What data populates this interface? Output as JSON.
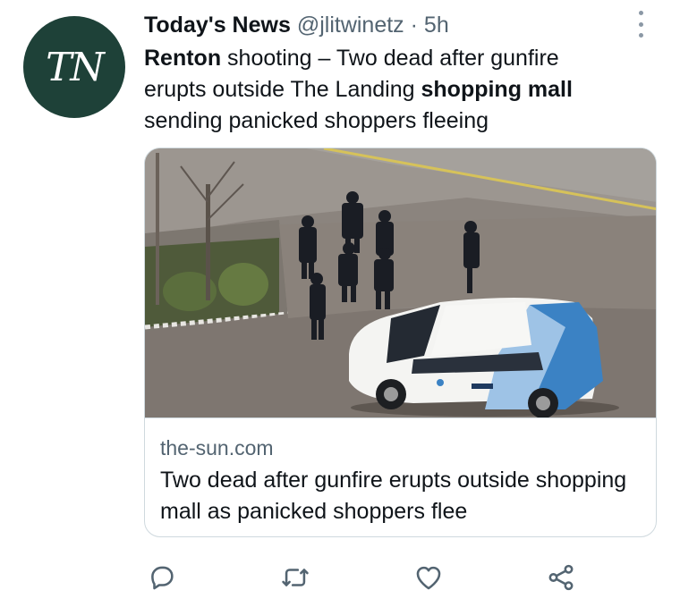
{
  "tweet": {
    "avatar_text": "TN",
    "author_name": "Today's News",
    "handle": "@jlitwinetz",
    "separator": "·",
    "time": "5h",
    "text_parts": {
      "p1_bold": "Renton",
      "p2": " shooting – Two dead after gunfire erupts outside The Landing ",
      "p3_bold": "shopping mall",
      "p4": " sending panicked shoppers fleeing"
    }
  },
  "card": {
    "domain": "the-sun.com",
    "title": "Two dead after gunfire erupts outside shopping mall as panicked shoppers flee",
    "image_content": "Aerial view of police officers standing near a white car on a street"
  },
  "actions": [
    {
      "name": "reply",
      "icon": "reply-icon"
    },
    {
      "name": "retweet",
      "icon": "retweet-icon"
    },
    {
      "name": "like",
      "icon": "heart-icon"
    },
    {
      "name": "share",
      "icon": "share-icon"
    }
  ],
  "colors": {
    "avatar_bg": "#1e4138",
    "secondary_text": "#536471",
    "icon": "#536471",
    "border": "#cfd9de"
  }
}
